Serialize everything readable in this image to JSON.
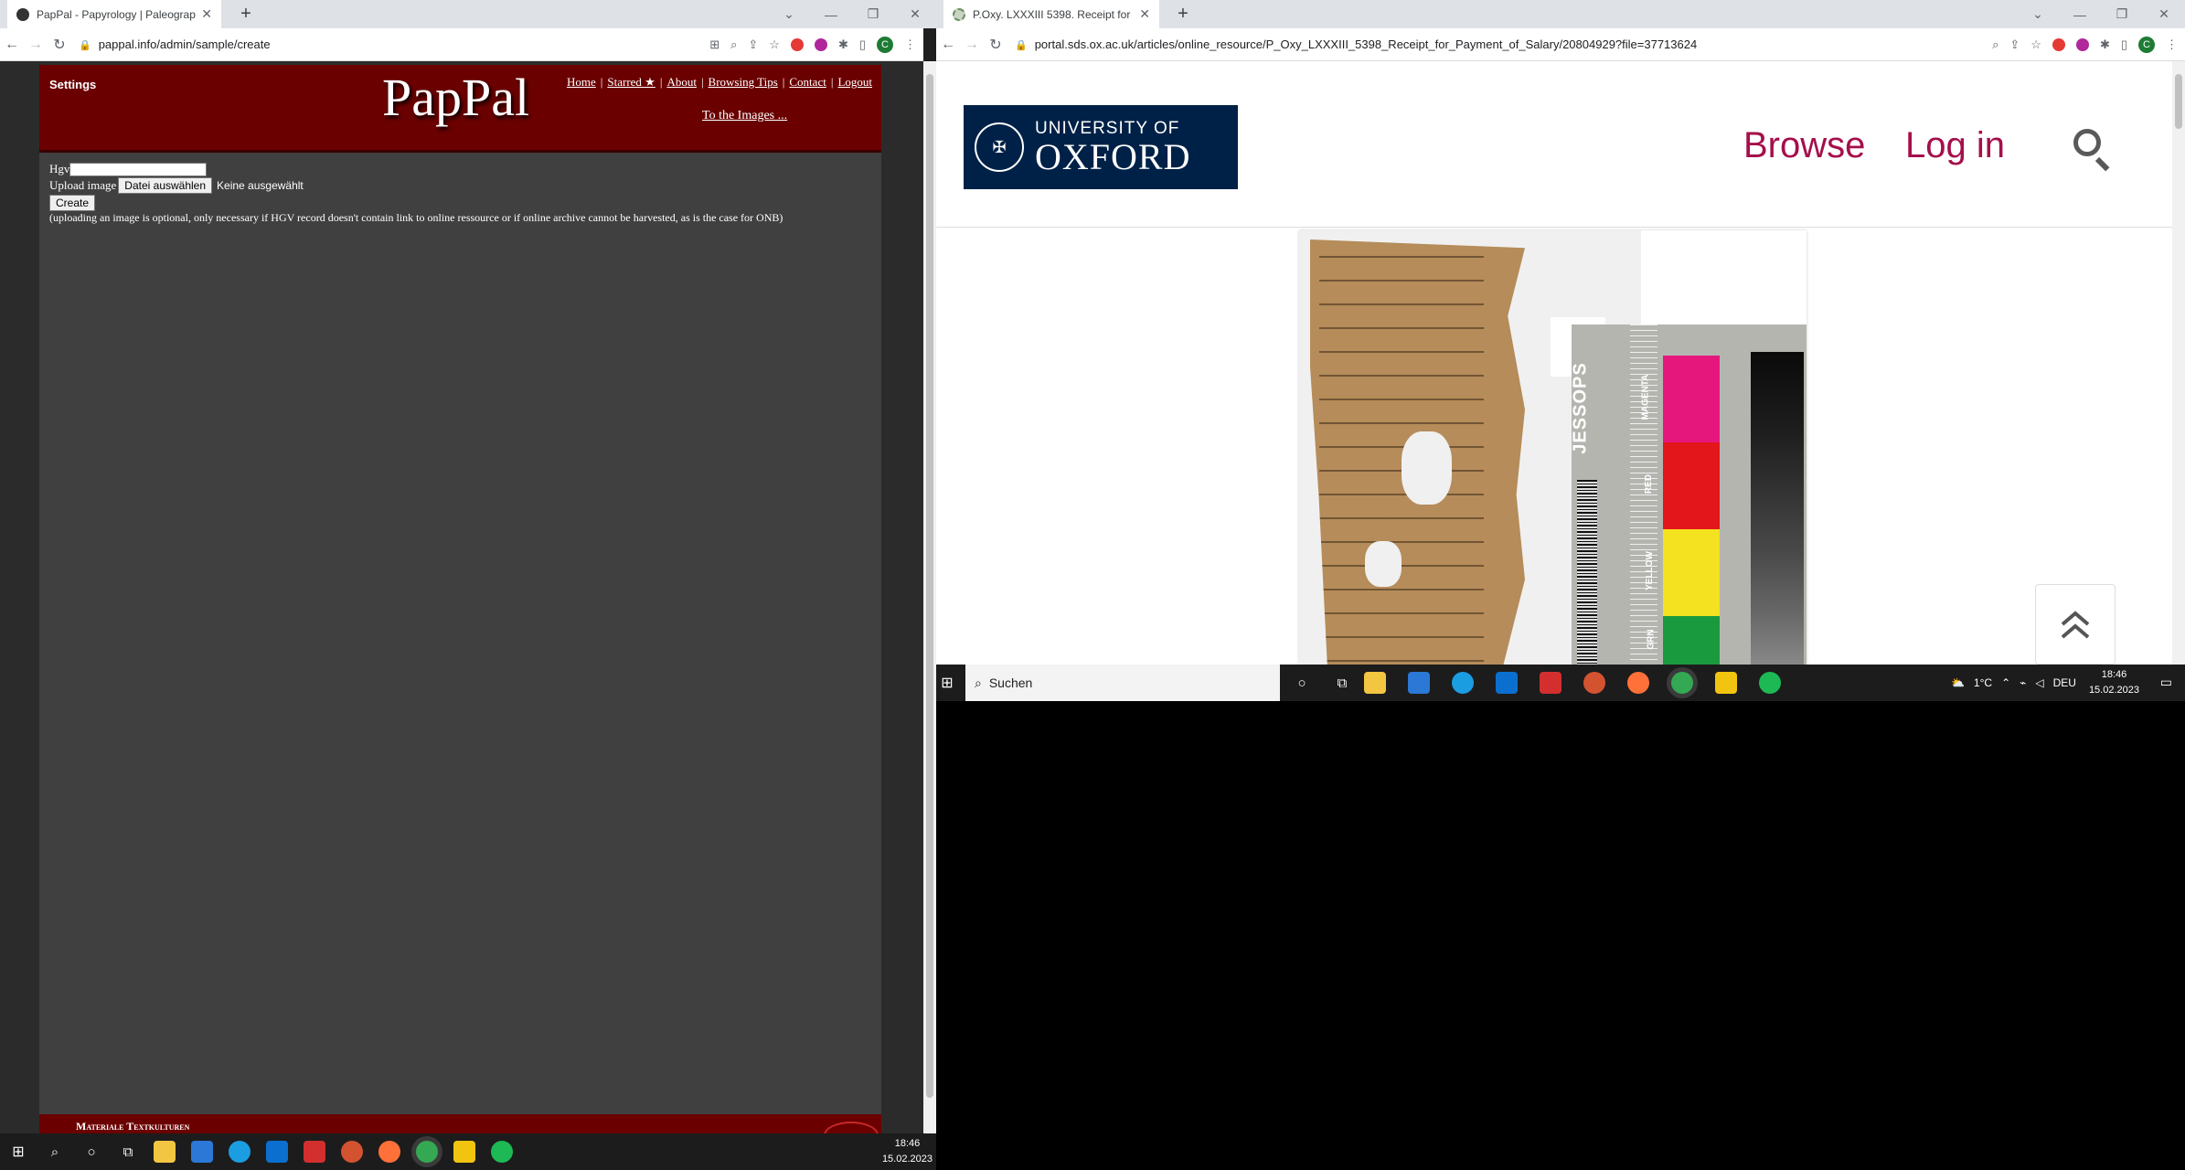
{
  "left_browser": {
    "tab_title": "PapPal - Papyrology | Paleograph",
    "url": "pappal.info/admin/sample/create",
    "profile_initial": "C",
    "page": {
      "settings": "Settings",
      "logo": "PapPal",
      "menu": [
        "Home",
        "Starred ★",
        "About",
        "Browsing Tips",
        "Contact",
        "Logout"
      ],
      "images_link": "To the Images ...",
      "hgv_label": "Hgv",
      "hgv_value": "",
      "upload_label": "Upload image",
      "file_button": "Datei auswählen",
      "file_status": "Keine ausgewählt",
      "create_button": "Create",
      "note": "(uploading an image is optional, only necessary if HGV record doesn't contain link to online ressource or if online archive cannot be harvested, as is the case for ONB)",
      "footer_text": "Materiale Textkulturen"
    }
  },
  "right_browser": {
    "tab_title": "P.Oxy. LXXXIII 5398. Receipt for",
    "url": "portal.sds.ox.ac.uk/articles/online_resource/P_Oxy_LXXXIII_5398_Receipt_for_Payment_of_Salary/20804929?file=37713624",
    "profile_initial": "C",
    "page": {
      "logo_line1": "UNIVERSITY OF",
      "logo_line2": "OXFORD",
      "browse": "Browse",
      "login": "Log in",
      "ruler_brand": "JESSOPS",
      "color_labels": [
        "MAGENTA",
        "RED",
        "YELLOW",
        "GRN"
      ]
    }
  },
  "taskbar_left": {
    "time": "18:46",
    "date": "15.02.2023"
  },
  "taskbar_right": {
    "search": "Suchen",
    "weather": "1°C",
    "lang": "DEU",
    "time": "18:46",
    "date": "15.02.2023"
  },
  "colors": {
    "pappal_red": "#6b0000",
    "pappal_bg": "#404040",
    "oxford_blue": "#002147",
    "oxford_link": "#a50f4b"
  }
}
